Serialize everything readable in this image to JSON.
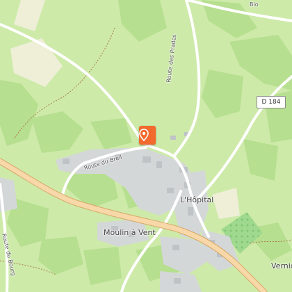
{
  "map": {
    "road_labels": {
      "route_des_prades": "Route des Prades",
      "route_du_breil": "Route du Breil",
      "route_du_bourg": "Route du Bourg"
    },
    "road_shield": "D 184",
    "places": {
      "lhopital": "L'Hôpital",
      "moulin_a_vent": "Moulin à Vent",
      "verniq": "Verniq"
    },
    "edge_fragment": "Bio",
    "marker_icon": "map-pin-icon",
    "colors": {
      "land": "#cdeaa9",
      "forest": "#b6df8f",
      "farmland": "#efefd8",
      "orchard": "#9fd88f",
      "road": "#ffffff",
      "main_road": "#f8d8a8",
      "built_area": "#d4d7d8",
      "marker": "#f26a2e"
    }
  }
}
